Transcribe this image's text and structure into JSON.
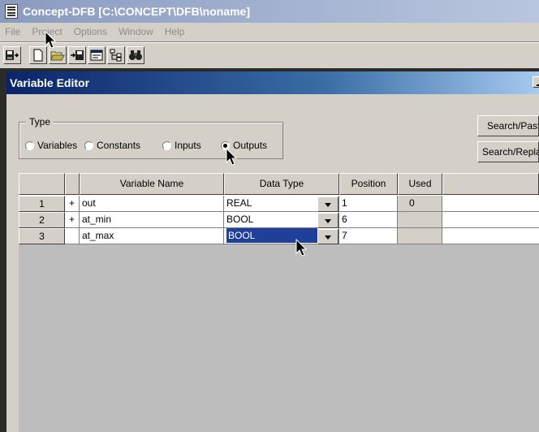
{
  "app": {
    "title": "Concept-DFB [C:\\CONCEPT\\DFB\\noname]"
  },
  "menu": [
    "File",
    "Project",
    "Options",
    "Window",
    "Help"
  ],
  "toolbar": [
    "save-exit-icon",
    "new-icon",
    "open-icon",
    "import-export-icon",
    "properties-icon",
    "tree-icon",
    "find-binoculars-icon"
  ],
  "dialog": {
    "title": "Variable Editor",
    "type_group": {
      "label": "Type",
      "options": [
        "Variables",
        "Constants",
        "Inputs",
        "Outputs"
      ],
      "selected": "Outputs"
    },
    "buttons": {
      "search_paste": "Search/Paste",
      "search_replace": "Search/Replace"
    },
    "grid": {
      "headers": {
        "name": "Variable Name",
        "type": "Data Type",
        "position": "Position",
        "used": "Used"
      },
      "rows": [
        {
          "num": "1",
          "mark": "+",
          "name": "out",
          "type": "REAL",
          "position": "1",
          "used": "0"
        },
        {
          "num": "2",
          "mark": "+",
          "name": "at_min",
          "type": "BOOL",
          "position": "6",
          "used": ""
        },
        {
          "num": "3",
          "mark": "",
          "name": "at_max",
          "type": "BOOL",
          "position": "7",
          "used": ""
        }
      ]
    }
  }
}
